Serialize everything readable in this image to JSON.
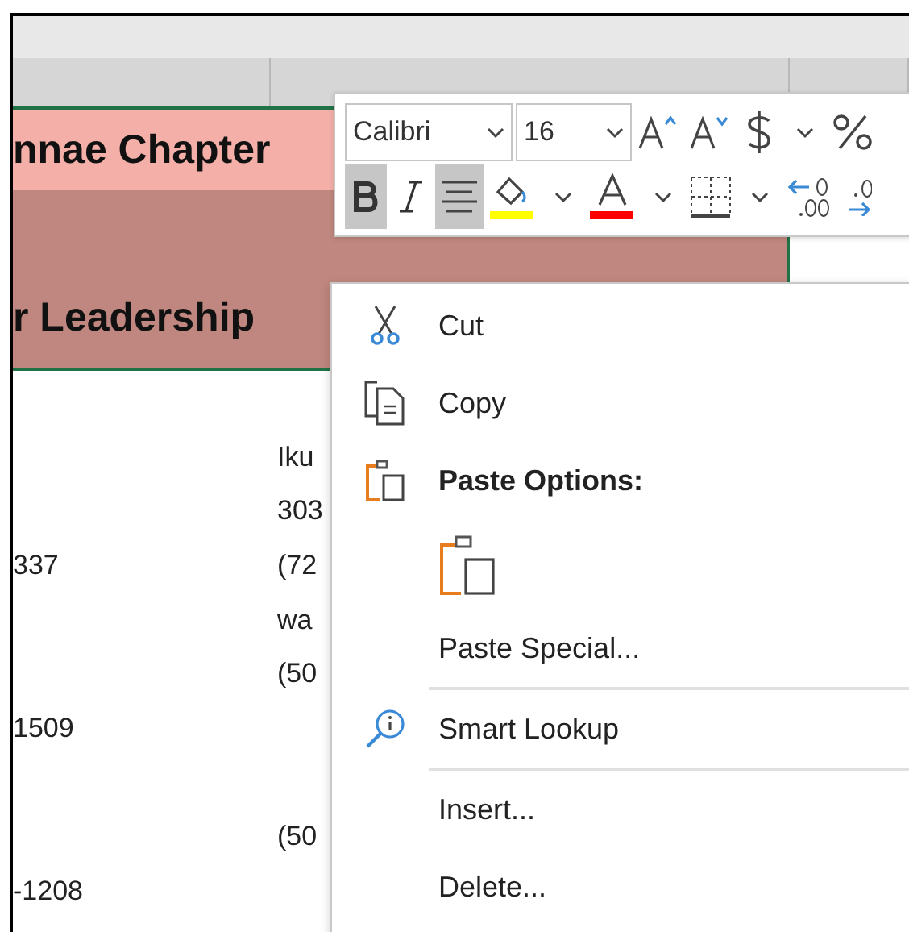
{
  "title_rows": [
    {
      "text": "nnae Chapter",
      "kind": "light"
    },
    {
      "text": "r Leadership",
      "kind": "dark"
    }
  ],
  "rows": [
    {
      "column_b": "",
      "column_c": "Iku"
    },
    {
      "column_b": "",
      "column_c": "303"
    },
    {
      "column_b": "337",
      "column_c": "(72"
    },
    {
      "column_b": "",
      "column_c": "wa"
    },
    {
      "column_b": "",
      "column_c": "(50"
    },
    {
      "column_b": "1509",
      "column_c": ""
    },
    {
      "column_b": "",
      "column_c": ""
    },
    {
      "column_b": "",
      "column_c": "(50"
    },
    {
      "column_b": "-1208",
      "column_c": ""
    }
  ],
  "mini_toolbar": {
    "font": "Calibri",
    "size": "16",
    "row_1": [
      {
        "kind": "grow"
      },
      {
        "kind": "shrink"
      },
      {
        "kind": "currency"
      },
      {
        "kind": "caret"
      },
      {
        "kind": "percent"
      }
    ],
    "row_2": [
      {
        "kind": "bold",
        "selected": true
      },
      {
        "kind": "italic",
        "selected": false
      },
      {
        "kind": "center",
        "selected": true
      },
      {
        "kind": "fill",
        "color": "#ffff00"
      },
      {
        "kind": "caret"
      },
      {
        "kind": "font-color",
        "color": "#ff0000"
      },
      {
        "kind": "caret"
      },
      {
        "kind": "borders"
      },
      {
        "kind": "caret"
      },
      {
        "kind": "decrease-decimal"
      },
      {
        "kind": "increase-decimal"
      }
    ]
  },
  "context_menu": [
    {
      "kind": "cut",
      "label": "Cut"
    },
    {
      "kind": "copy",
      "label": "Copy"
    },
    {
      "kind": "paste-heading",
      "label": "Paste Options:"
    },
    {
      "kind": "paste-option"
    },
    {
      "kind": "item",
      "label": "Paste Special..."
    },
    {
      "kind": "separator"
    },
    {
      "kind": "lookup",
      "label": "Smart Lookup"
    },
    {
      "kind": "separator"
    },
    {
      "kind": "item",
      "label": "Insert..."
    },
    {
      "kind": "item",
      "label": "Delete..."
    }
  ]
}
